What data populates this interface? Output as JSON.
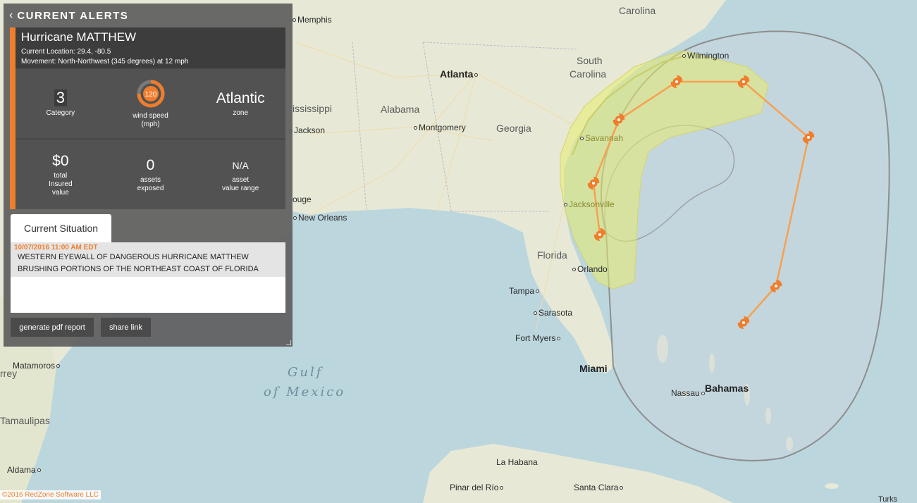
{
  "panel": {
    "title": "CURRENT ALERTS",
    "storm_name": "Hurricane MATTHEW",
    "current_location": "Current Location: 29.4, -80.5",
    "movement": "Movement: North-Northwest (345 degrees) at 12 mph",
    "stats": [
      {
        "value": "3",
        "label": "Category"
      },
      {
        "value": "120",
        "label": "wind speed\n(mph)"
      },
      {
        "value": "Atlantic",
        "label": "zone"
      },
      {
        "value": "$0",
        "label": "total\nInsured\nvalue"
      },
      {
        "value": "0",
        "label": "assets\nexposed"
      },
      {
        "value": "N/A",
        "label": "asset\nvalue range"
      }
    ],
    "situation_tab": "Current Situation",
    "situation_time": "10/07/2016 11:00 AM EDT",
    "situation_line1": "WESTERN EYEWALL OF DANGEROUS HURRICANE MATTHEW",
    "situation_line2": "BRUSHING PORTIONS OF THE NORTHEAST COAST OF FLORIDA",
    "btn_pdf": "generate pdf report",
    "btn_share": "share link"
  },
  "map_labels": {
    "carolina": "Carolina",
    "memphis": "Memphis",
    "south_carolina_1": "South",
    "south_carolina_2": "Carolina",
    "wilmington": "Wilmington",
    "atlanta": "Atlanta",
    "mississippi": "ississippi",
    "alabama": "Alabama",
    "georgia": "Georgia",
    "montgomery": "Montgomery",
    "jackson": "Jackson",
    "savannah": "Savannah",
    "jacksonville": "Jacksonville",
    "rouge": "ouge",
    "new_orleans": "New Orleans",
    "florida": "Florida",
    "orlando": "Orlando",
    "tampa": "Tampa",
    "sarasota": "Sarasota",
    "fort_myers": "Fort Myers",
    "miami": "Miami",
    "gulf1": "Gulf",
    "gulf2": "of Mexico",
    "nassau": "Nassau",
    "bahamas": "Bahamas",
    "matamoros": "Matamoros",
    "rrey": "rrey",
    "tamaulipas": "Tamaulipas",
    "aldama": "Aldama",
    "la_habana": "La Habana",
    "pinar": "Pinar del Río",
    "santa_clara": "Santa Clara",
    "turks": "Turks"
  },
  "copyright": "©2016 RedZone Software LLC",
  "colors": {
    "accent": "#f07d2c",
    "track": "#f7a050",
    "cone_fill": "#e8ec7a",
    "uncertainty": "#8a8a8a"
  }
}
